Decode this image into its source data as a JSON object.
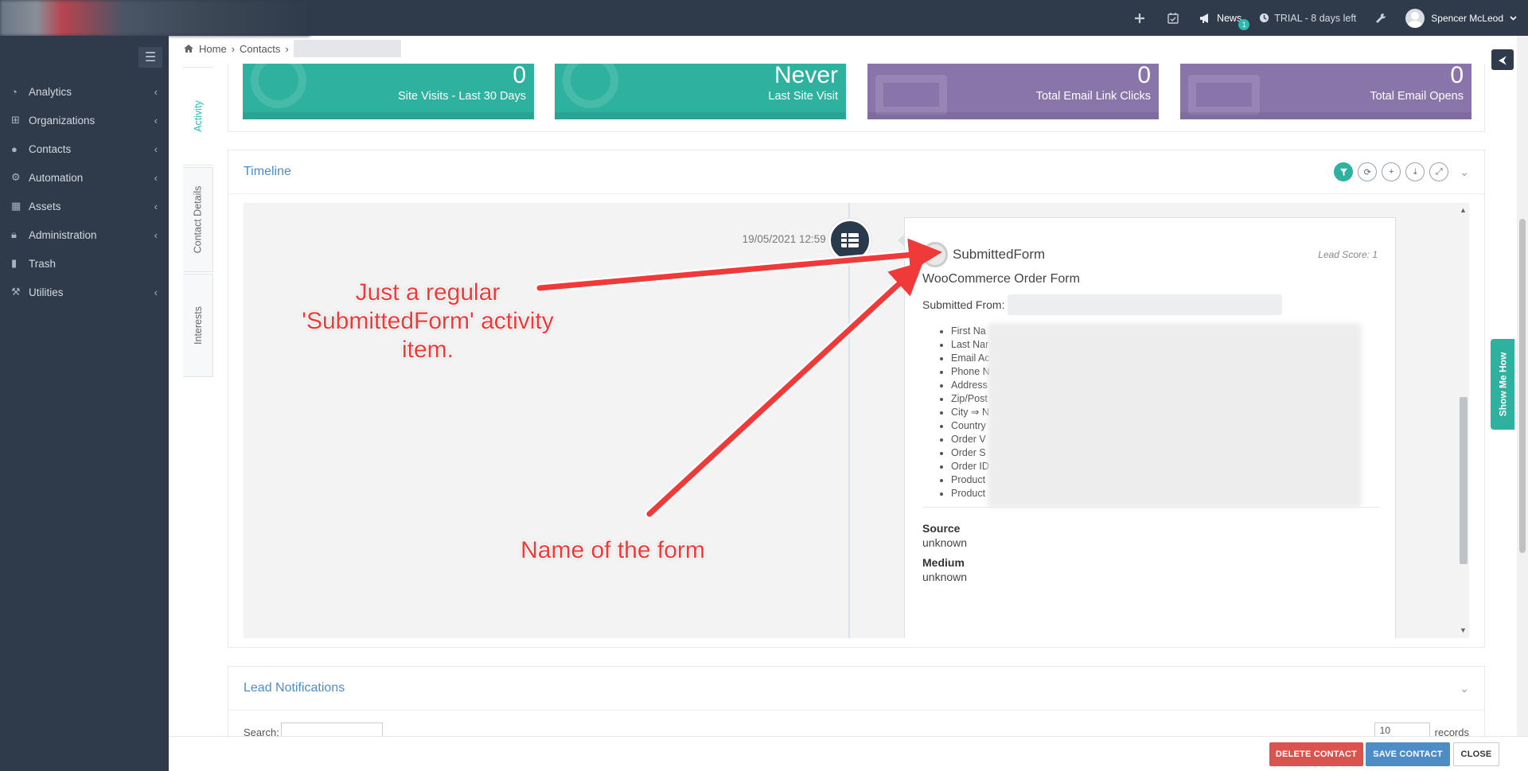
{
  "topbar": {
    "news_label": "News",
    "news_count": "1",
    "trial_label": "TRIAL - 8 days left",
    "user_name": "Spencer McLeod",
    "icons": [
      "plus-icon",
      "calendar-check-icon",
      "megaphone-icon",
      "clock-icon",
      "wrench-icon",
      "chevron-down-icon"
    ]
  },
  "sidebar": {
    "items": [
      {
        "label": "Analytics",
        "icon": "dashboard-icon"
      },
      {
        "label": "Organizations",
        "icon": "sitemap-icon"
      },
      {
        "label": "Contacts",
        "icon": "users-icon"
      },
      {
        "label": "Automation",
        "icon": "cogs-icon"
      },
      {
        "label": "Assets",
        "icon": "grid-icon"
      },
      {
        "label": "Administration",
        "icon": "lock-icon"
      },
      {
        "label": "Trash",
        "icon": "trash-icon"
      },
      {
        "label": "Utilities",
        "icon": "wrench-icon"
      }
    ]
  },
  "breadcrumb": {
    "home": "Home",
    "contacts": "Contacts"
  },
  "vtabs": {
    "activity": "Activity",
    "details": "Contact Details",
    "interests": "Interests"
  },
  "stats": [
    {
      "value": "0",
      "caption": "Site Visits - Last 30 Days",
      "color": "#2eb29f"
    },
    {
      "value": "Never",
      "caption": "Last Site Visit",
      "color": "#2eb29f"
    },
    {
      "value": "0",
      "caption": "Total Email Link Clicks",
      "color": "#8a75ab"
    },
    {
      "value": "0",
      "caption": "Total Email Opens",
      "color": "#8a75ab"
    }
  ],
  "timeline": {
    "title": "Timeline",
    "date": "19/05/2021 12:59 AM",
    "event": "SubmittedForm",
    "lead_score": "Lead Score: 1",
    "form_name": "WooCommerce Order Form",
    "submitted_from": "Submitted From:",
    "fields": [
      "First Na",
      "Last Nar",
      "Email Ac",
      "Phone N",
      "Address",
      "Zip/Post",
      "City ⇒ N",
      "Country",
      "Order V",
      "Order S",
      "Order ID",
      "Product",
      "Product"
    ],
    "source_label": "Source",
    "source_value": "unknown",
    "medium_label": "Medium",
    "medium_value": "unknown"
  },
  "lead": {
    "title": "Lead Notifications",
    "search_label": "Search:",
    "page_size": "10",
    "records_label": "records"
  },
  "actions": {
    "delete": "DELETE CONTACT",
    "save": "SAVE CONTACT",
    "close": "CLOSE"
  },
  "showme": "Show Me How",
  "annotations": {
    "first": "Just a regular 'SubmittedForm' activity item.",
    "second": "Name of the form"
  },
  "colors": {
    "accent": "#2eb29f",
    "link": "#4e8cc6",
    "sidebar": "#2f3b4a",
    "annotation": "#f03a3a"
  }
}
